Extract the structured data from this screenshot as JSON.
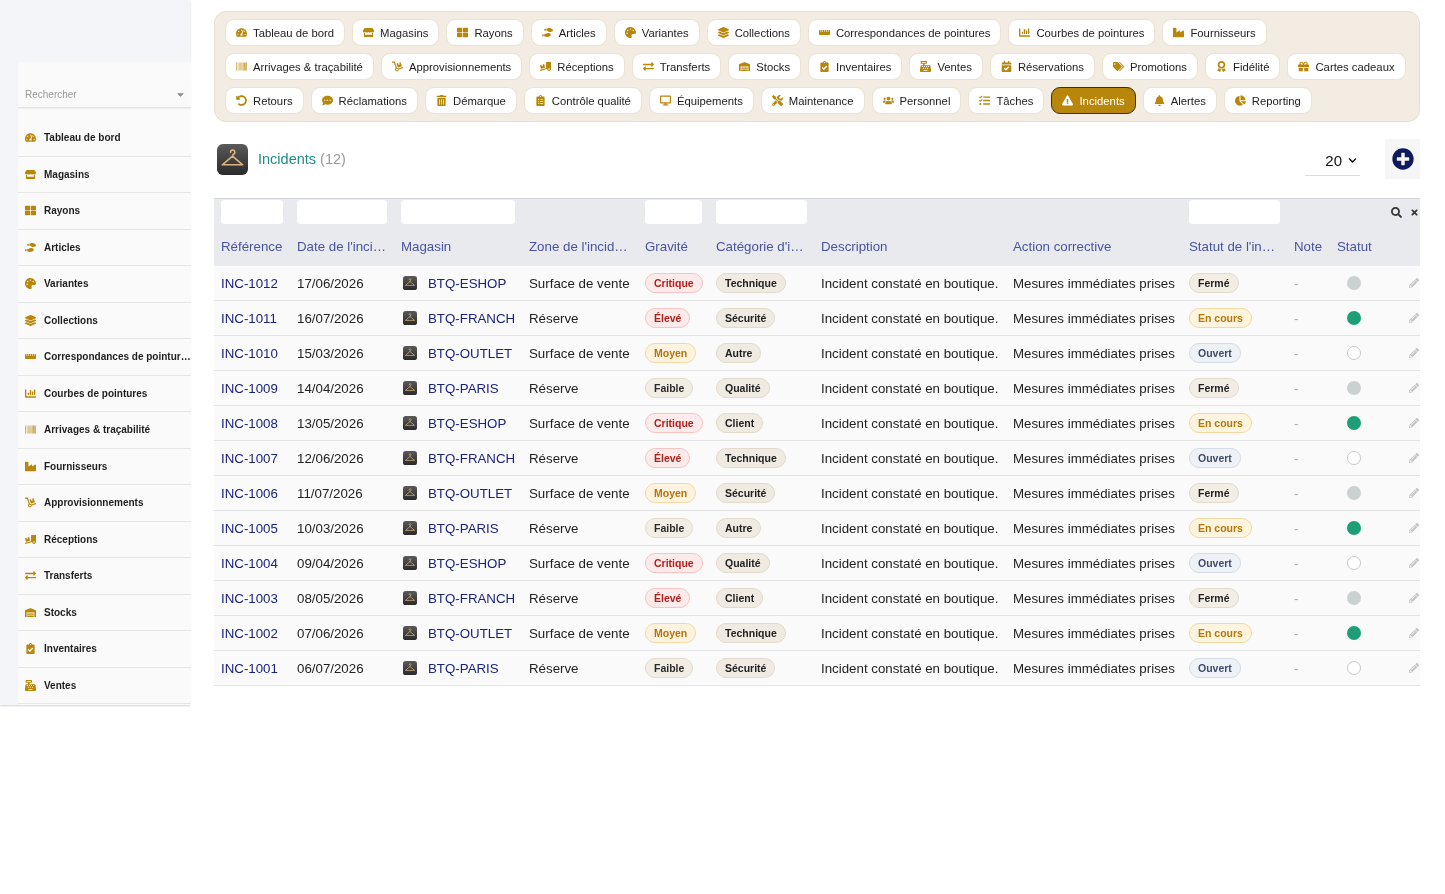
{
  "sidebar": {
    "search": {
      "placeholder": "Rechercher"
    },
    "items": [
      "Tableau de bord",
      "Magasins",
      "Rayons",
      "Articles",
      "Variantes",
      "Collections",
      "Correspondances de pointur…",
      "Courbes de pointures",
      "Arrivages & traçabilité",
      "Fournisseurs",
      "Approvisionnements",
      "Réceptions",
      "Transferts",
      "Stocks",
      "Inventaires",
      "Ventes"
    ]
  },
  "nav": {
    "items": [
      {
        "label": "Tableau de bord",
        "selected": false
      },
      {
        "label": "Magasins",
        "selected": false
      },
      {
        "label": "Rayons",
        "selected": false
      },
      {
        "label": "Articles",
        "selected": false
      },
      {
        "label": "Variantes",
        "selected": false
      },
      {
        "label": "Collections",
        "selected": false
      },
      {
        "label": "Correspondances de pointures",
        "selected": false
      },
      {
        "label": "Courbes de pointures",
        "selected": false
      },
      {
        "label": "Fournisseurs",
        "selected": false
      },
      {
        "label": "Arrivages & traçabilité",
        "selected": false
      },
      {
        "label": "Approvisionnements",
        "selected": false
      },
      {
        "label": "Réceptions",
        "selected": false
      },
      {
        "label": "Transferts",
        "selected": false
      },
      {
        "label": "Stocks",
        "selected": false
      },
      {
        "label": "Inventaires",
        "selected": false
      },
      {
        "label": "Ventes",
        "selected": false
      },
      {
        "label": "Réservations",
        "selected": false
      },
      {
        "label": "Promotions",
        "selected": false
      },
      {
        "label": "Fidélité",
        "selected": false
      },
      {
        "label": "Cartes cadeaux",
        "selected": false
      },
      {
        "label": "Retours",
        "selected": false
      },
      {
        "label": "Réclamations",
        "selected": false
      },
      {
        "label": "Démarque",
        "selected": false
      },
      {
        "label": "Contrôle qualité",
        "selected": false
      },
      {
        "label": "Équipements",
        "selected": false
      },
      {
        "label": "Maintenance",
        "selected": false
      },
      {
        "label": "Personnel",
        "selected": false
      },
      {
        "label": "Tâches",
        "selected": false
      },
      {
        "label": "Incidents",
        "selected": true
      },
      {
        "label": "Alertes",
        "selected": false
      },
      {
        "label": "Reporting",
        "selected": false
      }
    ]
  },
  "header": {
    "title": "Incidents",
    "count": "(12)",
    "page_size": "20"
  },
  "table": {
    "columns": [
      {
        "label": "Référence",
        "filter": true
      },
      {
        "label": "Date de l'inci…",
        "filter": true
      },
      {
        "label": "Magasin",
        "filter": true
      },
      {
        "label": "Zone de l'incid…",
        "filter": false
      },
      {
        "label": "Gravité",
        "filter": true
      },
      {
        "label": "Catégorie d'i…",
        "filter": true
      },
      {
        "label": "Description",
        "filter": false
      },
      {
        "label": "Action corrective",
        "filter": false
      },
      {
        "label": "Statut de l'in…",
        "filter": true
      },
      {
        "label": "Note",
        "filter": false
      },
      {
        "label": "Statut",
        "filter": false
      }
    ],
    "rows": [
      {
        "reference": "INC-1012",
        "date": "17/06/2026",
        "store": "BTQ-ESHOP",
        "zone": "Surface de vente",
        "severity": {
          "label": "Critique",
          "kind": "critical"
        },
        "category": "Technique",
        "description": "Incident constaté en boutique.",
        "action": "Mesures immédiates prises",
        "status": {
          "label": "Fermé",
          "kind": "closed"
        },
        "note": "-",
        "status_dot": {
          "kind": "filled",
          "color": "#cbd1d1"
        }
      },
      {
        "reference": "INC-1011",
        "date": "16/07/2026",
        "store": "BTQ-FRANCH",
        "zone": "Réserve",
        "severity": {
          "label": "Élevé",
          "kind": "high"
        },
        "category": "Sécurité",
        "description": "Incident constaté en boutique.",
        "action": "Mesures immédiates prises",
        "status": {
          "label": "En cours",
          "kind": "in_progress"
        },
        "note": "-",
        "status_dot": {
          "kind": "filled",
          "color": "#1e9e76"
        }
      },
      {
        "reference": "INC-1010",
        "date": "15/03/2026",
        "store": "BTQ-OUTLET",
        "zone": "Surface de vente",
        "severity": {
          "label": "Moyen",
          "kind": "medium"
        },
        "category": "Autre",
        "description": "Incident constaté en boutique.",
        "action": "Mesures immédiates prises",
        "status": {
          "label": "Ouvert",
          "kind": "open"
        },
        "note": "-",
        "status_dot": {
          "kind": "ring",
          "color": "#c4caca"
        }
      },
      {
        "reference": "INC-1009",
        "date": "14/04/2026",
        "store": "BTQ-PARIS",
        "zone": "Réserve",
        "severity": {
          "label": "Faible",
          "kind": "low"
        },
        "category": "Qualité",
        "description": "Incident constaté en boutique.",
        "action": "Mesures immédiates prises",
        "status": {
          "label": "Fermé",
          "kind": "closed"
        },
        "note": "-",
        "status_dot": {
          "kind": "filled",
          "color": "#cbd1d1"
        }
      },
      {
        "reference": "INC-1008",
        "date": "13/05/2026",
        "store": "BTQ-ESHOP",
        "zone": "Surface de vente",
        "severity": {
          "label": "Critique",
          "kind": "critical"
        },
        "category": "Client",
        "description": "Incident constaté en boutique.",
        "action": "Mesures immédiates prises",
        "status": {
          "label": "En cours",
          "kind": "in_progress"
        },
        "note": "-",
        "status_dot": {
          "kind": "filled",
          "color": "#1e9e76"
        }
      },
      {
        "reference": "INC-1007",
        "date": "12/06/2026",
        "store": "BTQ-FRANCH",
        "zone": "Réserve",
        "severity": {
          "label": "Élevé",
          "kind": "high"
        },
        "category": "Technique",
        "description": "Incident constaté en boutique.",
        "action": "Mesures immédiates prises",
        "status": {
          "label": "Ouvert",
          "kind": "open"
        },
        "note": "-",
        "status_dot": {
          "kind": "ring",
          "color": "#c4caca"
        }
      },
      {
        "reference": "INC-1006",
        "date": "11/07/2026",
        "store": "BTQ-OUTLET",
        "zone": "Surface de vente",
        "severity": {
          "label": "Moyen",
          "kind": "medium"
        },
        "category": "Sécurité",
        "description": "Incident constaté en boutique.",
        "action": "Mesures immédiates prises",
        "status": {
          "label": "Fermé",
          "kind": "closed"
        },
        "note": "-",
        "status_dot": {
          "kind": "filled",
          "color": "#cbd1d1"
        }
      },
      {
        "reference": "INC-1005",
        "date": "10/03/2026",
        "store": "BTQ-PARIS",
        "zone": "Réserve",
        "severity": {
          "label": "Faible",
          "kind": "low"
        },
        "category": "Autre",
        "description": "Incident constaté en boutique.",
        "action": "Mesures immédiates prises",
        "status": {
          "label": "En cours",
          "kind": "in_progress"
        },
        "note": "-",
        "status_dot": {
          "kind": "filled",
          "color": "#1e9e76"
        }
      },
      {
        "reference": "INC-1004",
        "date": "09/04/2026",
        "store": "BTQ-ESHOP",
        "zone": "Surface de vente",
        "severity": {
          "label": "Critique",
          "kind": "critical"
        },
        "category": "Qualité",
        "description": "Incident constaté en boutique.",
        "action": "Mesures immédiates prises",
        "status": {
          "label": "Ouvert",
          "kind": "open"
        },
        "note": "-",
        "status_dot": {
          "kind": "ring",
          "color": "#c4caca"
        }
      },
      {
        "reference": "INC-1003",
        "date": "08/05/2026",
        "store": "BTQ-FRANCH",
        "zone": "Réserve",
        "severity": {
          "label": "Élevé",
          "kind": "high"
        },
        "category": "Client",
        "description": "Incident constaté en boutique.",
        "action": "Mesures immédiates prises",
        "status": {
          "label": "Fermé",
          "kind": "closed"
        },
        "note": "-",
        "status_dot": {
          "kind": "filled",
          "color": "#cbd1d1"
        }
      },
      {
        "reference": "INC-1002",
        "date": "07/06/2026",
        "store": "BTQ-OUTLET",
        "zone": "Surface de vente",
        "severity": {
          "label": "Moyen",
          "kind": "medium"
        },
        "category": "Technique",
        "description": "Incident constaté en boutique.",
        "action": "Mesures immédiates prises",
        "status": {
          "label": "En cours",
          "kind": "in_progress"
        },
        "note": "-",
        "status_dot": {
          "kind": "filled",
          "color": "#1e9e76"
        }
      },
      {
        "reference": "INC-1001",
        "date": "06/07/2026",
        "store": "BTQ-PARIS",
        "zone": "Réserve",
        "severity": {
          "label": "Faible",
          "kind": "low"
        },
        "category": "Sécurité",
        "description": "Incident constaté en boutique.",
        "action": "Mesures immédiates prises",
        "status": {
          "label": "Ouvert",
          "kind": "open"
        },
        "note": "-",
        "status_dot": {
          "kind": "ring",
          "color": "#c4caca"
        }
      }
    ]
  }
}
